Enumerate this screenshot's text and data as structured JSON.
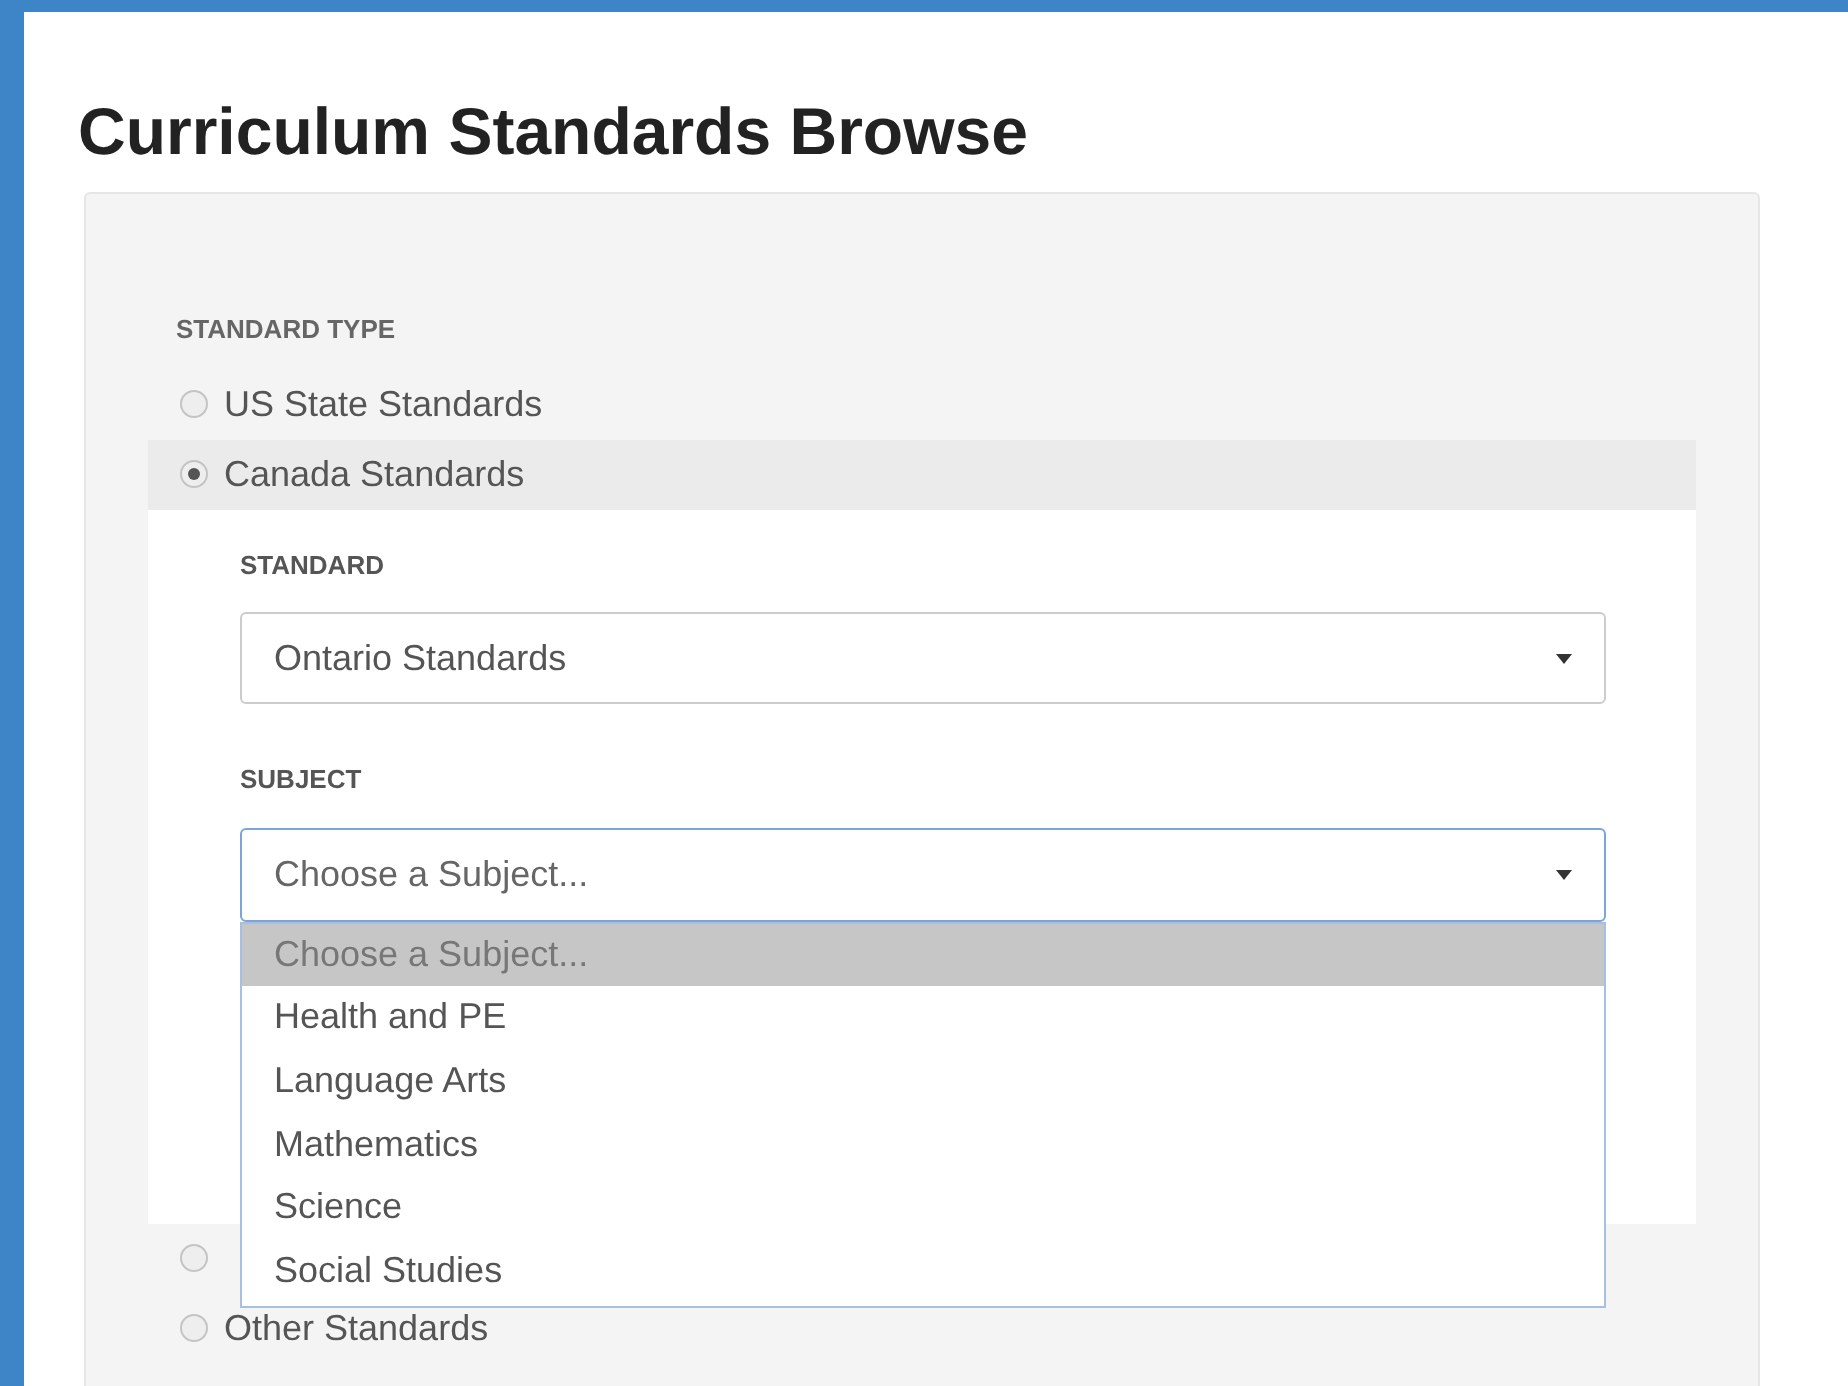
{
  "title": "Curriculum Standards Browse",
  "standard_type": {
    "label": "STANDARD TYPE",
    "options": [
      {
        "label": "US State Standards",
        "selected": false
      },
      {
        "label": "Canada Standards",
        "selected": true
      },
      {
        "selected": false
      },
      {
        "label": "Other Standards",
        "selected": false
      }
    ]
  },
  "standard": {
    "label": "STANDARD",
    "value": "Ontario Standards"
  },
  "subject": {
    "label": "SUBJECT",
    "value": "Choose a Subject...",
    "expanded": true,
    "options": [
      {
        "label": "Choose a Subject...",
        "selected": true
      },
      {
        "label": "Health and PE",
        "selected": false
      },
      {
        "label": "Language Arts",
        "selected": false
      },
      {
        "label": "Mathematics",
        "selected": false
      },
      {
        "label": "Science",
        "selected": false
      },
      {
        "label": "Social Studies",
        "selected": false
      }
    ]
  }
}
